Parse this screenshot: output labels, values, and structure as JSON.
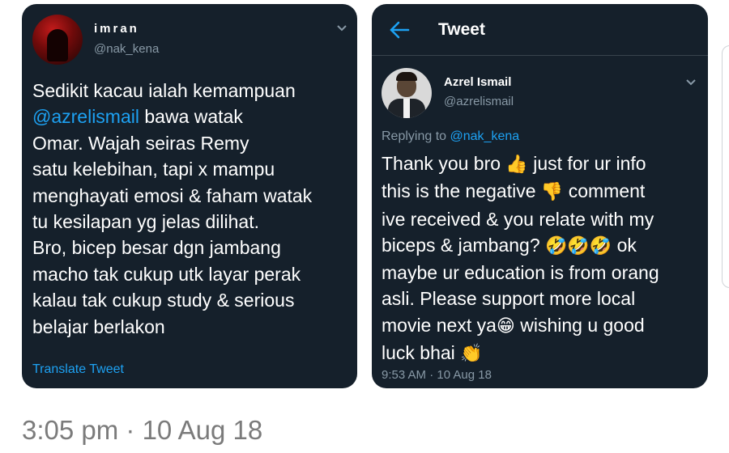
{
  "left_tweet": {
    "display_name": "imran",
    "handle": "@nak_kena",
    "lines": [
      [
        {
          "text": "Sedikit kacau ialah kemampuan"
        }
      ],
      [
        {
          "text": "@azrelismail",
          "mention": true
        },
        {
          "text": " bawa watak"
        }
      ],
      [
        {
          "text": "Omar. Wajah seiras Remy"
        }
      ],
      [
        {
          "text": "satu kelebihan, tapi x mampu"
        }
      ],
      [
        {
          "text": "menghayati emosi & faham watak"
        }
      ],
      [
        {
          "text": "tu kesilapan yg jelas dilihat."
        }
      ],
      [
        {
          "text": "Bro, bicep besar dgn jambang"
        }
      ],
      [
        {
          "text": "macho tak cukup utk layar perak"
        }
      ],
      [
        {
          "text": "kalau tak cukup study & serious"
        }
      ],
      [
        {
          "text": "belajar berlakon"
        }
      ]
    ],
    "translate_label": "Translate Tweet",
    "avatar_icon": "profile-photo-red",
    "menu_icon": "chevron-down-icon"
  },
  "right_panel": {
    "header_title": "Tweet",
    "back_icon": "back-arrow-icon",
    "tweet": {
      "display_name": "Azrel Ismail",
      "handle": "@azrelismail",
      "replying_prefix": "Replying to ",
      "replying_handle": "@nak_kena",
      "lines": [
        [
          {
            "text": "Thank you bro "
          },
          {
            "text": "👍",
            "emoji": true
          },
          {
            "text": " just for ur info"
          }
        ],
        [
          {
            "text": "this is the negative "
          },
          {
            "text": "👎",
            "emoji": true
          },
          {
            "text": " comment"
          }
        ],
        [
          {
            "text": "ive received & you relate with my"
          }
        ],
        [
          {
            "text": "biceps & jambang? "
          },
          {
            "text": "🤣🤣🤣",
            "emoji": true
          },
          {
            "text": " ok"
          }
        ],
        [
          {
            "text": "maybe ur education is from orang"
          }
        ],
        [
          {
            "text": "asli. Please support more local"
          }
        ],
        [
          {
            "text": "movie next ya"
          },
          {
            "text": "😁",
            "emoji": true
          },
          {
            "text": " wishing u good"
          }
        ],
        [
          {
            "text": "luck bhai "
          },
          {
            "text": "👏",
            "emoji": true
          }
        ]
      ],
      "timestamp": "9:53 AM · 10 Aug 18",
      "avatar_icon": "profile-photo-man-in-suit",
      "menu_icon": "chevron-down-icon"
    }
  },
  "footer": {
    "timestamp": "3:05 pm · 10 Aug 18"
  },
  "colors": {
    "panel_bg": "#15202b",
    "text_primary": "#ffffff",
    "text_secondary": "#8899a6",
    "accent": "#1da1f2",
    "footer_text": "#7b7b7b"
  }
}
